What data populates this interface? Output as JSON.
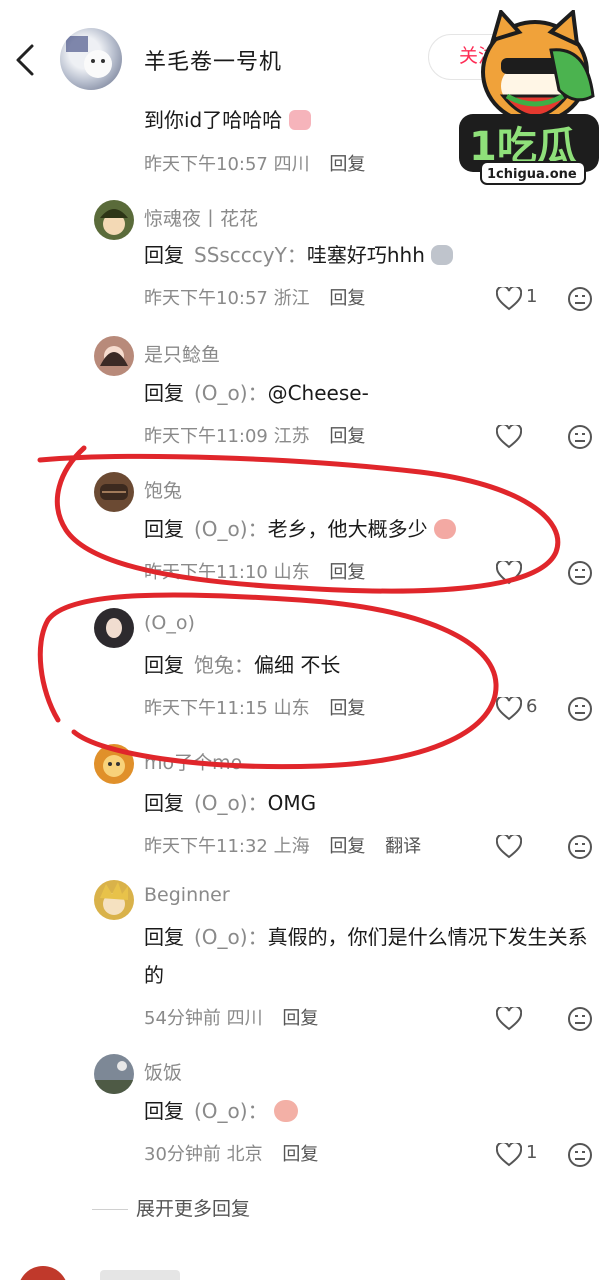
{
  "header": {
    "title": "羊毛卷一号机",
    "follow_label": "关注"
  },
  "watermark": {
    "brand": "1吃瓜",
    "url": "1chigua.one"
  },
  "top_comment": {
    "text_tail": "到你id了哈哈哈",
    "time": "昨天下午10:57",
    "location": "四川",
    "reply_label": "回复"
  },
  "replies": [
    {
      "name": "惊魂夜丨花花",
      "reply_prefix": "回复",
      "target": "SSscccyY",
      "text": "哇塞好巧hhh",
      "time": "昨天下午10:57",
      "location": "浙江",
      "reply_label": "回复",
      "likes": "1",
      "avatar_color": "#5a6b3a"
    },
    {
      "name": "是只鲶鱼",
      "reply_prefix": "回复",
      "target": "(O_o)",
      "text": "@Cheese-",
      "time": "昨天下午11:09",
      "location": "江苏",
      "reply_label": "回复",
      "likes": "",
      "avatar_color": "#b88a7a"
    },
    {
      "name": "饱兔",
      "reply_prefix": "回复",
      "target": "(O_o)",
      "text": "老乡，他大概多少",
      "time": "昨天下午11:10",
      "location": "山东",
      "reply_label": "回复",
      "likes": "",
      "avatar_color": "#6b4a33"
    },
    {
      "name": "(O_o)",
      "reply_prefix": "回复",
      "target": "饱兔",
      "text": "偏细 不长",
      "time": "昨天下午11:15",
      "location": "山东",
      "reply_label": "回复",
      "likes": "6",
      "avatar_color": "#2d2a2e"
    },
    {
      "name": "mo了个mo",
      "reply_prefix": "回复",
      "target": "(O_o)",
      "text": "OMG",
      "time": "昨天下午11:32",
      "location": "上海",
      "reply_label": "回复",
      "translate_label": "翻译",
      "likes": "",
      "avatar_color": "#e0902a"
    },
    {
      "name": "Beginner",
      "reply_prefix": "回复",
      "target": "(O_o)",
      "text": "真假的，你们是什么情况下发生关系的",
      "time": "54分钟前",
      "location": "四川",
      "reply_label": "回复",
      "likes": "",
      "avatar_color": "#d9b24a"
    },
    {
      "name": "饭饭",
      "reply_prefix": "回复",
      "target": "(O_o)",
      "text": "",
      "time": "30分钟前",
      "location": "北京",
      "reply_label": "回复",
      "likes": "1",
      "avatar_color": "#7d8896"
    }
  ],
  "expand_label": "展开更多回复",
  "colors": {
    "annotation_red": "#e0262b",
    "muted": "#8a8a8a",
    "text": "#1a1a1a"
  }
}
